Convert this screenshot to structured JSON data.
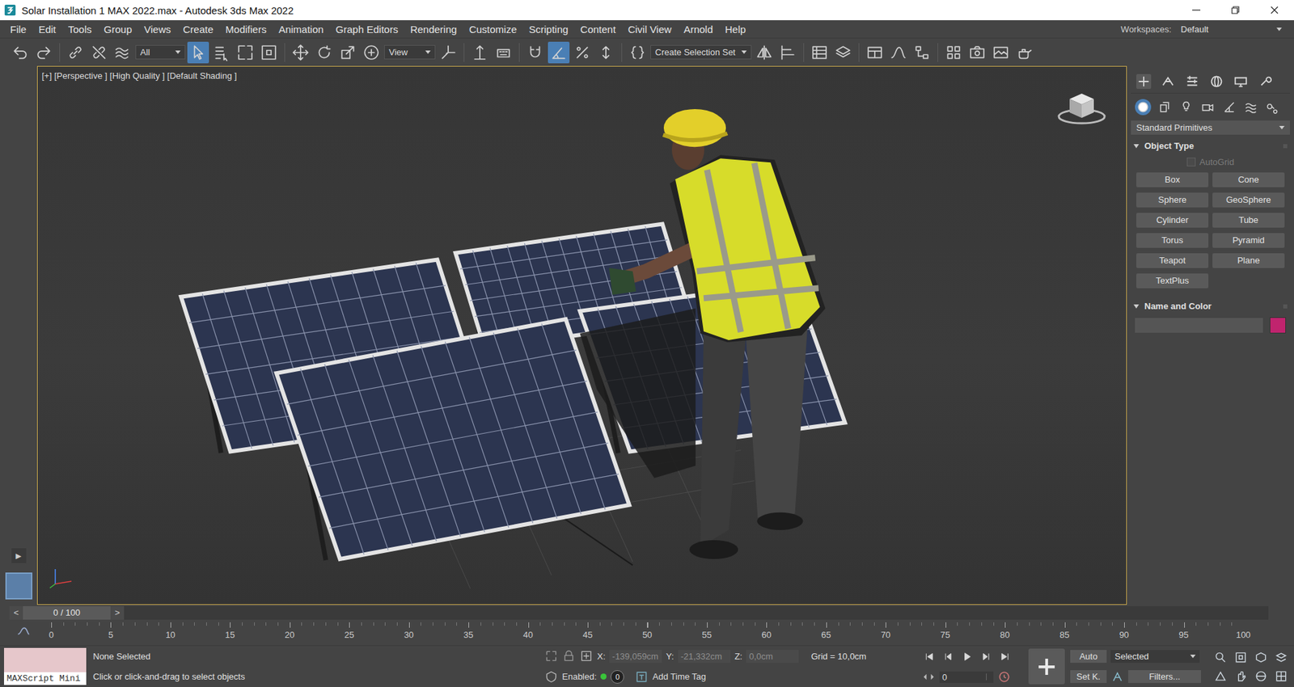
{
  "window": {
    "title": "Solar Installation 1 MAX 2022.max - Autodesk 3ds Max 2022"
  },
  "menu": [
    "File",
    "Edit",
    "Tools",
    "Group",
    "Views",
    "Create",
    "Modifiers",
    "Animation",
    "Graph Editors",
    "Rendering",
    "Customize",
    "Scripting",
    "Content",
    "Civil View",
    "Arnold",
    "Help"
  ],
  "workspaces": {
    "label": "Workspaces:",
    "value": "Default"
  },
  "toolbar": {
    "filter": "All",
    "coord_system": "View",
    "selection_set": "Create Selection Set",
    "select_object_active": true,
    "angle_snap_active": true
  },
  "viewport": {
    "label": "[+] [Perspective ] [High Quality ] [Default Shading ]",
    "active": true
  },
  "left_strip": {
    "expand": "▶"
  },
  "command_panel": {
    "tabs": [
      {
        "selected": true
      },
      {
        "selected": false
      },
      {
        "selected": false
      },
      {
        "selected": false
      },
      {
        "selected": false
      },
      {
        "selected": false
      }
    ],
    "categories": [
      {
        "selected": true
      },
      {
        "selected": false
      },
      {
        "selected": false
      },
      {
        "selected": false
      },
      {
        "selected": false
      },
      {
        "selected": false
      },
      {
        "selected": false
      }
    ],
    "category_dropdown": "Standard Primitives",
    "object_type": {
      "title": "Object Type",
      "autogrid": {
        "label": "AutoGrid",
        "checked": false,
        "disabled": true
      },
      "buttons": [
        "Box",
        "Cone",
        "Sphere",
        "GeoSphere",
        "Cylinder",
        "Tube",
        "Torus",
        "Pyramid",
        "Teapot",
        "Plane",
        "TextPlus"
      ]
    },
    "name_and_color": {
      "title": "Name and Color",
      "name": "",
      "color": "#c0246e"
    }
  },
  "time_slider": {
    "prev": "<",
    "reading": "0 / 100",
    "next": ">",
    "level": 0
  },
  "track_bar": {
    "ticks": [
      "0",
      "5",
      "10",
      "15",
      "20",
      "25",
      "30",
      "35",
      "40",
      "45",
      "50",
      "55",
      "60",
      "65",
      "70",
      "75",
      "80",
      "85",
      "90",
      "95",
      "100"
    ]
  },
  "status_bar": {
    "maxscript": "MAXScript Mini",
    "selection": "None Selected",
    "prompt": "Click or click-and-drag to select objects",
    "x_label": "X:",
    "x": "-139,059cm",
    "y_label": "Y:",
    "y": "-21,332cm",
    "z_label": "Z:",
    "z": "0,0cm",
    "grid": "Grid = 10,0cm",
    "enabled_label": "Enabled:",
    "enabled": true,
    "time_tag_count": "0",
    "add_time_tag": "Add Time Tag",
    "auto_key": "Auto",
    "auto_key_on": false,
    "key_filter": "Selected",
    "set_key": "Set K.",
    "filters": "Filters...",
    "frame": "0"
  }
}
